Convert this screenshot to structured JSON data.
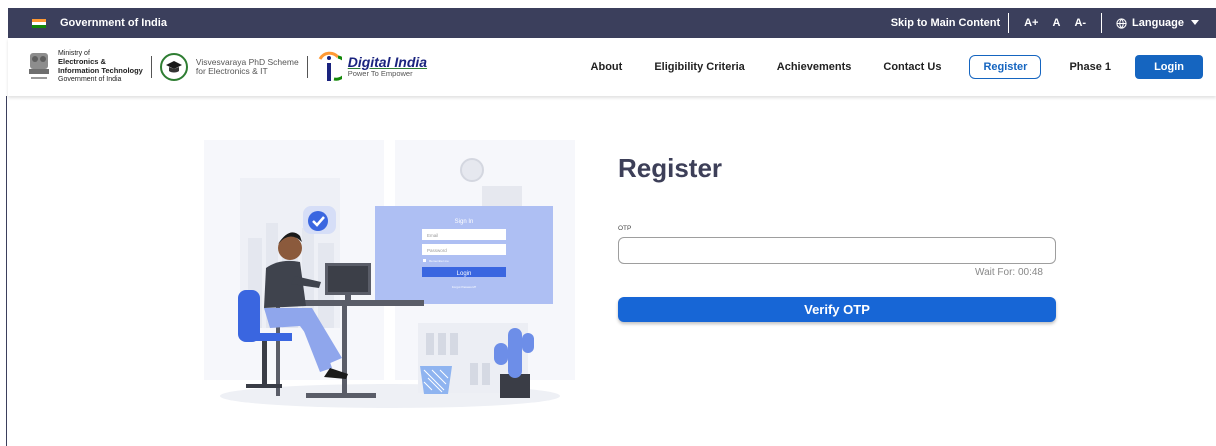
{
  "govbar": {
    "title": "Government of India",
    "skip": "Skip to Main Content",
    "font_larger": "A+",
    "font_normal": "A",
    "font_smaller": "A-",
    "language": "Language"
  },
  "header": {
    "meity_line1": "Ministry of",
    "meity_line2": "Electronics &",
    "meity_line3": "Information Technology",
    "meity_line4": "Government of India",
    "scheme_line1": "Visvesvaraya PhD Scheme",
    "scheme_line2": "for Electronics & IT",
    "di_title": "Digital India",
    "di_tag": "Power To Empower"
  },
  "nav": {
    "about": "About",
    "eligibility": "Eligibility Criteria",
    "achievements": "Achievements",
    "contact": "Contact Us",
    "register": "Register",
    "phase": "Phase 1",
    "login": "Login"
  },
  "illustration": {
    "signin_title": "Sign In",
    "email_ph": "Email",
    "password_ph": "Password",
    "remember": "Remember me",
    "login_btn": "Login",
    "forgot": "Forgot Password?"
  },
  "form": {
    "title": "Register",
    "otp_label": "OTP",
    "otp_value": "",
    "wait_text": "Wait For: 00:48",
    "verify_label": "Verify OTP"
  },
  "colors": {
    "govbar_bg": "#3b3f5c",
    "primary": "#1565c0",
    "verify_bg": "#1766d6"
  }
}
